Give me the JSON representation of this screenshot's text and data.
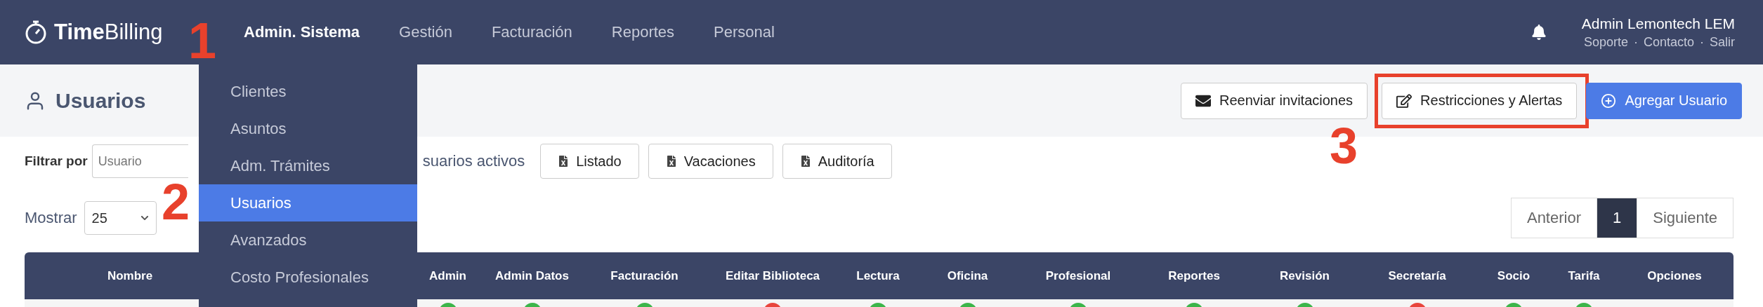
{
  "navbar": {
    "logo": "**Time**Billing",
    "menu": [
      {
        "label": "Admin. Sistema",
        "selected": true
      },
      {
        "label": "Gestión",
        "selected": false
      },
      {
        "label": "Facturación",
        "selected": false
      },
      {
        "label": "Reportes",
        "selected": false
      },
      {
        "label": "Personal",
        "selected": false
      }
    ],
    "user": {
      "name": "Admin Lemontech LEM",
      "separator": "·",
      "links": [
        "Soporte",
        "Contacto",
        "Salir"
      ]
    }
  },
  "dropdown": {
    "items": [
      {
        "label": "Clientes",
        "selected": false
      },
      {
        "label": "Asuntos",
        "selected": false
      },
      {
        "label": "Adm. Trámites",
        "selected": false
      },
      {
        "label": "Usuarios",
        "selected": true
      },
      {
        "label": "Avanzados",
        "selected": false
      },
      {
        "label": "Costo Profesionales",
        "selected": false
      }
    ]
  },
  "page": {
    "title": "Usuarios",
    "actions": [
      {
        "label": "Reenviar invitaciones",
        "kind": "mail",
        "highlighted": false
      },
      {
        "label": "Restricciones y Alertas",
        "kind": "edit",
        "highlighted": true
      },
      {
        "label": "Agregar Usuario",
        "kind": "add",
        "highlighted": false
      }
    ]
  },
  "filter": {
    "label": "Filtrar por",
    "placeholder": "Usuario",
    "active_label": "suarios activos",
    "exports": [
      "Listado",
      "Vacaciones",
      "Auditoría"
    ]
  },
  "show": {
    "label": "Mostrar",
    "value": "25"
  },
  "pagination": [
    {
      "label": "Anterior",
      "selected": false
    },
    {
      "label": "1",
      "selected": true
    },
    {
      "label": "Siguiente",
      "selected": false
    }
  ],
  "table": {
    "columns": [
      "Nombre",
      "",
      "Admin",
      "Admin Datos",
      "Facturación",
      "Editar Biblioteca",
      "Lectura",
      "Oficina",
      "Profesional",
      "Reportes",
      "Revisión",
      "Secretaría",
      "Socio",
      "Tarifa",
      "Opciones"
    ],
    "first_row": [
      {
        "color": "#3cb54a"
      },
      {
        "color": "#3cb54a"
      },
      {
        "color": "#3cb54a"
      },
      {
        "color": "#e8453c"
      },
      {
        "color": "#3cb54a"
      },
      {
        "color": "#3cb54a"
      },
      {
        "color": "#3cb54a"
      },
      {
        "color": "#3cb54a"
      },
      {
        "color": "#3cb54a"
      },
      {
        "color": "#e8453c"
      },
      {
        "color": "#3cb54a"
      },
      {
        "color": "#3cb54a"
      }
    ]
  },
  "annotations": [
    "1",
    "2",
    "3"
  ]
}
